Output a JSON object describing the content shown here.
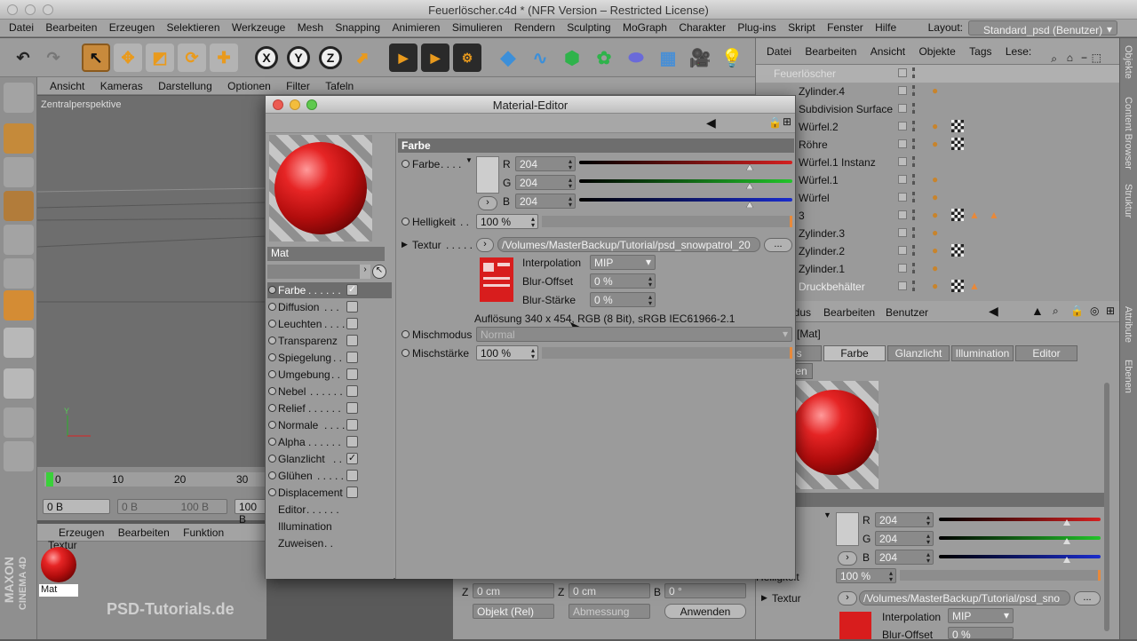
{
  "window": {
    "title": "Feuerlöscher.c4d * (NFR Version – Restricted License)"
  },
  "menu": {
    "items": [
      "Datei",
      "Bearbeiten",
      "Erzeugen",
      "Selektieren",
      "Werkzeuge",
      "Mesh",
      "Snapping",
      "Animieren",
      "Simulieren",
      "Rendern",
      "Sculpting",
      "MoGraph",
      "Charakter",
      "Plug-ins",
      "Skript",
      "Fenster",
      "Hilfe"
    ],
    "layout_label": "Layout:",
    "layout_value": "Standard_psd (Benutzer)"
  },
  "viewport": {
    "menu": [
      "Ansicht",
      "Kameras",
      "Darstellung",
      "Optionen",
      "Filter",
      "Tafeln"
    ],
    "label": "Zentralperspektive",
    "axis_y": "Y"
  },
  "timeline": {
    "ticks": [
      "0",
      "10",
      "20",
      "30"
    ],
    "field_a": "0 B",
    "field_b": "0 B",
    "field_c": "100 B",
    "field_d": "100 B"
  },
  "material_manager": {
    "menu": [
      "Erzeugen",
      "Bearbeiten",
      "Funktion",
      "Textur"
    ],
    "material_name": "Mat"
  },
  "branding": {
    "maxon": "MAXON",
    "cinema": "CINEMA 4D",
    "psd": "PSD-Tutorials.de"
  },
  "coords": {
    "z1_label": "Z",
    "z1_value": "0 cm",
    "z2_label": "Z",
    "z2_value": "0 cm",
    "b_label": "B",
    "b_value": "0 °",
    "mode": "Objekt (Rel)",
    "size": "Abmessung",
    "apply": "Anwenden"
  },
  "objects": {
    "menu": [
      "Datei",
      "Bearbeiten",
      "Ansicht",
      "Objekte",
      "Tags",
      "Lese:"
    ],
    "rows": [
      "Feuerlöscher",
      "Zylinder.4",
      "Subdivision Surface",
      "Würfel.2",
      "Röhre",
      "Würfel.1 Instanz",
      "Würfel.1",
      "Würfel",
      "3",
      "Zylinder.3",
      "Zylinder.2",
      "Zylinder.1",
      "Druckbehälter"
    ]
  },
  "side_tabs": {
    "top": [
      "Objekte",
      "Content Browser",
      "Struktur"
    ],
    "bottom": [
      "Attribute",
      "Ebenen"
    ]
  },
  "attributes": {
    "menu": [
      "Modus",
      "Bearbeiten",
      "Benutzer"
    ],
    "title": "Material [Mat]",
    "tabs": [
      "Basis",
      "Farbe",
      "Glanzlicht",
      "Illumination",
      "Editor"
    ],
    "tab_row2": "Zuweisen",
    "r_value": "204",
    "g_value": "204",
    "b_value": "204",
    "helligkeit_label": "Helligkeit",
    "helligkeit_value": "100 %",
    "textur_label": "Textur",
    "textur_path": "/Volumes/MasterBackup/Tutorial/psd_sno",
    "interpolation_label": "Interpolation",
    "interpolation_value": "MIP",
    "blur_offset_label": "Blur-Offset",
    "blur_offset_value": "0 %"
  },
  "editor": {
    "title": "Material-Editor",
    "material_name": "Mat",
    "channels": [
      {
        "label": "Farbe",
        "checked": true,
        "selected": true
      },
      {
        "label": "Diffusion",
        "checked": false
      },
      {
        "label": "Leuchten",
        "checked": false
      },
      {
        "label": "Transparenz",
        "checked": false
      },
      {
        "label": "Spiegelung",
        "checked": false
      },
      {
        "label": "Umgebung",
        "checked": false
      },
      {
        "label": "Nebel",
        "checked": false
      },
      {
        "label": "Relief",
        "checked": false
      },
      {
        "label": "Normale",
        "checked": false
      },
      {
        "label": "Alpha",
        "checked": false
      },
      {
        "label": "Glanzlicht",
        "checked": true
      },
      {
        "label": "Glühen",
        "checked": false
      },
      {
        "label": "Displacement",
        "checked": false
      },
      {
        "label": "Editor",
        "checked": null
      },
      {
        "label": "Illumination",
        "checked": null
      },
      {
        "label": "Zuweisen",
        "checked": null
      }
    ],
    "section": "Farbe",
    "farbe_label": "Farbe",
    "r_label": "R",
    "r_value": "204",
    "g_label": "G",
    "g_value": "204",
    "b_label": "B",
    "b_value": "204",
    "color_level": 0.8,
    "helligkeit_label": "Helligkeit",
    "helligkeit_value": "100 %",
    "textur_label": "Textur",
    "textur_path": "/Volumes/MasterBackup/Tutorial/psd_snowpatrol_20",
    "textur_more": "...",
    "interpolation_label": "Interpolation",
    "interpolation_value": "MIP",
    "blur_offset_label": "Blur-Offset",
    "blur_offset_value": "0 %",
    "blur_staerke_label": "Blur-Stärke",
    "blur_staerke_value": "0 %",
    "resolution": "Auflösung 340 x 454, RGB (8 Bit), sRGB IEC61966-2.1",
    "mischmodus_label": "Mischmodus",
    "mischmodus_value": "Normal",
    "mischstaerke_label": "Mischstärke",
    "mischstaerke_value": "100 %"
  },
  "colors": {
    "red": "#d42020",
    "green": "#22c42a",
    "blue": "#1a2ccc",
    "accent_orange": "#e8893a"
  }
}
